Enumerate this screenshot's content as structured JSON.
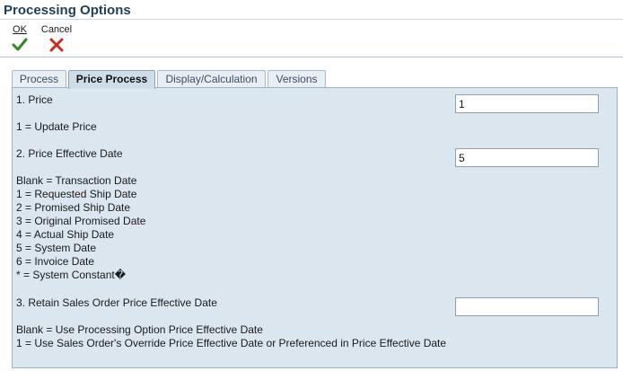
{
  "window": {
    "title": "Processing Options"
  },
  "toolbar": {
    "ok_label": "OK",
    "cancel_label": "Cancel"
  },
  "tabs": [
    {
      "label": "Process",
      "active": false
    },
    {
      "label": "Price Process",
      "active": true
    },
    {
      "label": "Display/Calculation",
      "active": false
    },
    {
      "label": "Versions",
      "active": false
    }
  ],
  "options": {
    "price": {
      "label": "1. Price",
      "value": "1",
      "descriptions": [
        "1 = Update Price"
      ]
    },
    "price_effective_date": {
      "label": "2. Price Effective Date",
      "value": "5",
      "descriptions": [
        "Blank = Transaction Date",
        "1 = Requested Ship Date",
        "2 = Promised Ship Date",
        "3 = Original Promised Date",
        "4 = Actual Ship Date",
        "5 = System Date",
        "6 = Invoice Date",
        "* = System Constant�"
      ]
    },
    "retain_date": {
      "label": "3. Retain Sales Order Price Effective Date",
      "value": "",
      "descriptions": [
        "Blank = Use Processing Option Price Effective Date",
        "1 = Use Sales Order's Override Price Effective Date or Preferenced in Price Effective Date"
      ]
    }
  },
  "colors": {
    "title": "#1e3f5a",
    "panel_bg": "#dbe6ef",
    "ok_icon": "#2e8b1e",
    "cancel_icon": "#cc2a1c"
  }
}
